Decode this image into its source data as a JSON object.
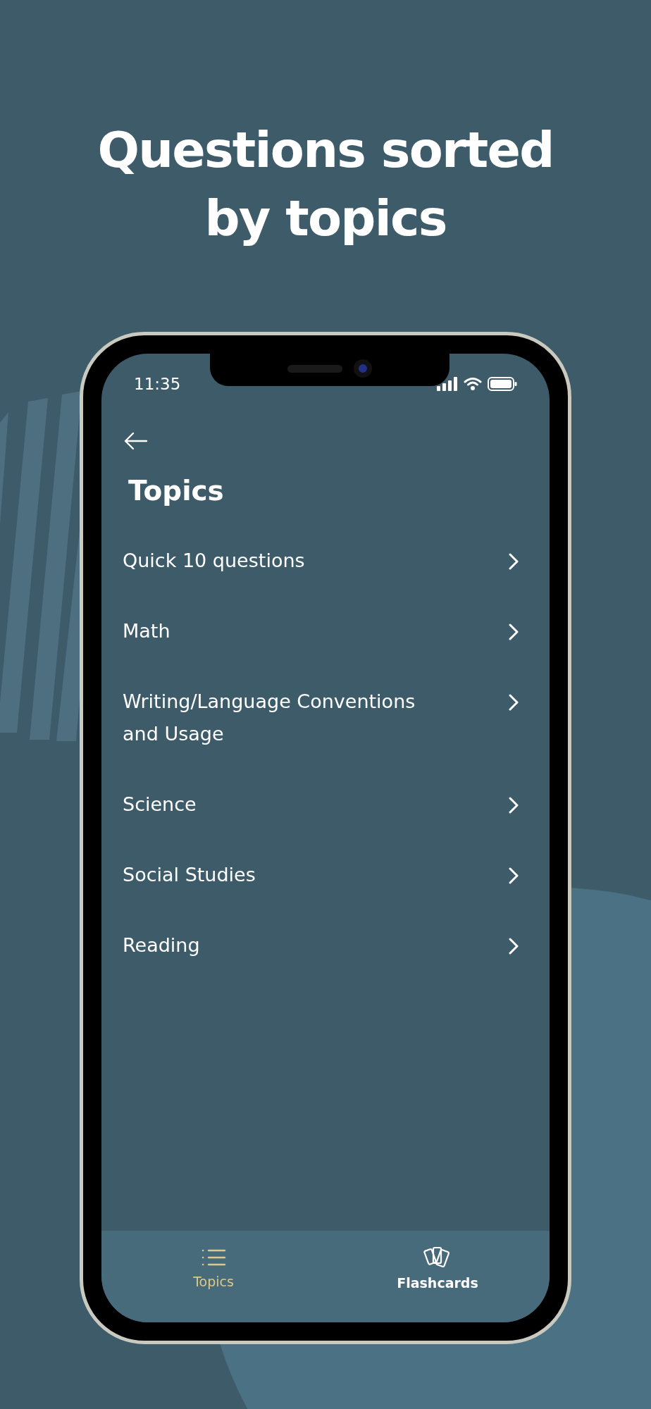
{
  "headline": "Questions sorted by topics",
  "status_bar": {
    "time": "11:35"
  },
  "screen": {
    "title": "Topics"
  },
  "topics": [
    {
      "label": "Quick 10 questions"
    },
    {
      "label": "Math"
    },
    {
      "label": "Writing/Language Conventions and Usage"
    },
    {
      "label": "Science"
    },
    {
      "label": "Social Studies"
    },
    {
      "label": "Reading"
    }
  ],
  "tabs": [
    {
      "label": "Topics",
      "kind": "list",
      "selected": true
    },
    {
      "label": "Flashcards",
      "kind": "cards",
      "selected": false
    }
  ]
}
